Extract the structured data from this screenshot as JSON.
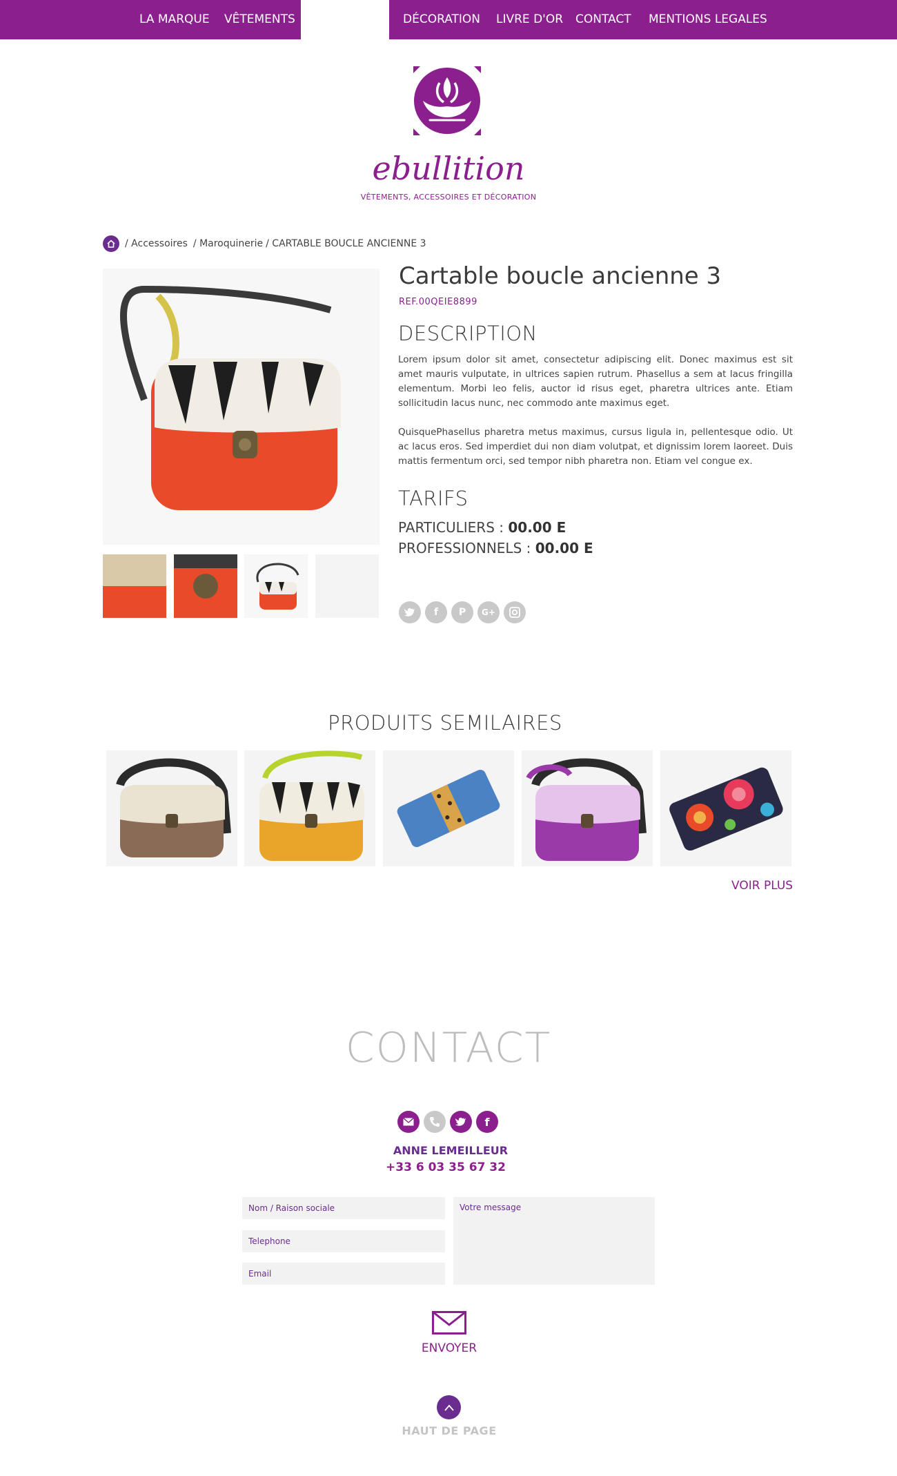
{
  "nav": {
    "items": [
      "LA MARQUE",
      "VÊTEMENTS",
      "DÉCORATION",
      "LIVRE D'OR",
      "CONTACT",
      "MENTIONS LEGALES"
    ]
  },
  "brand": {
    "name": "ebullition",
    "tagline": "VÊTEMENTS, ACCESSOIRES ET DÉCORATION"
  },
  "breadcrumb": {
    "items": [
      "/ Accessoires",
      "/ Maroquinerie",
      "/ CARTABLE BOUCLE ANCIENNE 3"
    ]
  },
  "product": {
    "title": "Cartable boucle ancienne 3",
    "ref": "REF.00QEIE8899",
    "description_heading": "DESCRIPTION",
    "paragraphs": [
      "Lorem ipsum dolor sit amet, consectetur adipiscing elit. Donec maximus est sit amet mauris vulputate, in ultrices sapien rutrum. Phasellus a sem at lacus fringilla elementum. Morbi leo felis, auctor id risus eget, pharetra ultrices ante. Etiam sollicitudin lacus nunc, nec commodo ante maximus eget.",
      "QuisquePhasellus pharetra metus maximus, cursus ligula in, pellentesque odio. Ut ac lacus eros. Sed imperdiet dui non diam volutpat, et dignissim lorem laoreet. Duis mattis fermentum orci, sed tempor nibh pharetra non. Etiam vel congue ex."
    ],
    "tarifs_heading": "TARIFS",
    "prices": [
      {
        "label": "PARTICULIERS :",
        "value": "00.00 E"
      },
      {
        "label": "PROFESSIONNELS :",
        "value": "00.00 E"
      }
    ]
  },
  "share": {
    "icons": [
      "twitter-icon",
      "facebook-icon",
      "pinterest-icon",
      "google-plus-icon",
      "instagram-icon"
    ]
  },
  "similar": {
    "title": "PRODUITS SEMILAIRES",
    "more": "VOIR PLUS"
  },
  "contact": {
    "title": "CONTACT",
    "name": "ANNE LEMEILLEUR",
    "phone": "+33 6 03 35 67 32",
    "placeholders": {
      "name": "Nom / Raison sociale",
      "phone": "Telephone",
      "email": "Email",
      "message": "Votre message"
    },
    "send": "ENVOYER"
  },
  "footer": {
    "top": "HAUT DE PAGE"
  },
  "colors": {
    "brand": "#8b1f8e",
    "dark_purple": "#6a2c8f",
    "grey_icon": "#c9c9c9",
    "field_bg": "#f2f2f2"
  }
}
